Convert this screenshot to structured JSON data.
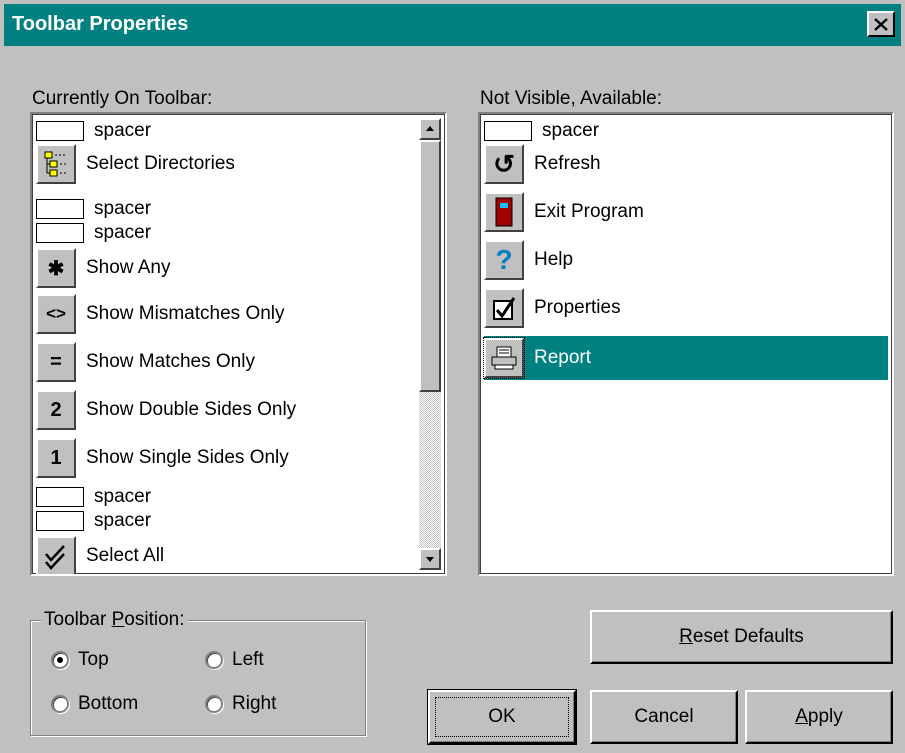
{
  "window": {
    "title": "Toolbar Properties",
    "close_symbol": "✕"
  },
  "left_list": {
    "label": "Currently On Toolbar:",
    "items": [
      {
        "kind": "spacer",
        "label": "spacer"
      },
      {
        "kind": "icon",
        "icon": "select-directories-icon",
        "label": "Select Directories"
      },
      {
        "kind": "spacer",
        "label": "spacer"
      },
      {
        "kind": "spacer",
        "label": "spacer"
      },
      {
        "kind": "icon",
        "icon": "asterisk-icon",
        "glyph": "✱",
        "label": "Show Any"
      },
      {
        "kind": "icon",
        "icon": "mismatch-icon",
        "glyph": "<>",
        "label": "Show Mismatches Only"
      },
      {
        "kind": "icon",
        "icon": "equals-icon",
        "glyph": "=",
        "label": "Show Matches Only"
      },
      {
        "kind": "icon",
        "icon": "number-two-icon",
        "glyph": "2",
        "label": "Show Double Sides Only"
      },
      {
        "kind": "icon",
        "icon": "number-one-icon",
        "glyph": "1",
        "label": "Show Single Sides Only"
      },
      {
        "kind": "spacer",
        "label": "spacer"
      },
      {
        "kind": "spacer",
        "label": "spacer"
      },
      {
        "kind": "icon",
        "icon": "select-all-icon",
        "label": "Select All"
      }
    ]
  },
  "right_list": {
    "label": "Not Visible, Available:",
    "items": [
      {
        "kind": "spacer",
        "label": "spacer"
      },
      {
        "kind": "icon",
        "icon": "refresh-icon",
        "glyph": "↺",
        "label": "Refresh"
      },
      {
        "kind": "icon",
        "icon": "exit-door-icon",
        "label": "Exit Program"
      },
      {
        "kind": "icon",
        "icon": "help-question-icon",
        "glyph": "?",
        "label": "Help"
      },
      {
        "kind": "icon",
        "icon": "checkbox-properties-icon",
        "label": "Properties"
      },
      {
        "kind": "icon",
        "icon": "printer-report-icon",
        "label": "Report",
        "selected": true
      }
    ]
  },
  "position_group": {
    "legend_pre": "Toolbar ",
    "legend_key": "P",
    "legend_post": "osition:",
    "options": [
      {
        "label": "Top",
        "checked": true
      },
      {
        "label": "Left",
        "checked": false
      },
      {
        "label": "Bottom",
        "checked": false
      },
      {
        "label": "Right",
        "checked": false
      }
    ]
  },
  "buttons": {
    "reset_key": "R",
    "reset_rest": "eset Defaults",
    "ok": "OK",
    "cancel": "Cancel",
    "apply_key": "A",
    "apply_rest": "pply"
  },
  "colors": {
    "title_bar": "#008080",
    "selection": "#008080",
    "face": "#c0c0c0"
  }
}
